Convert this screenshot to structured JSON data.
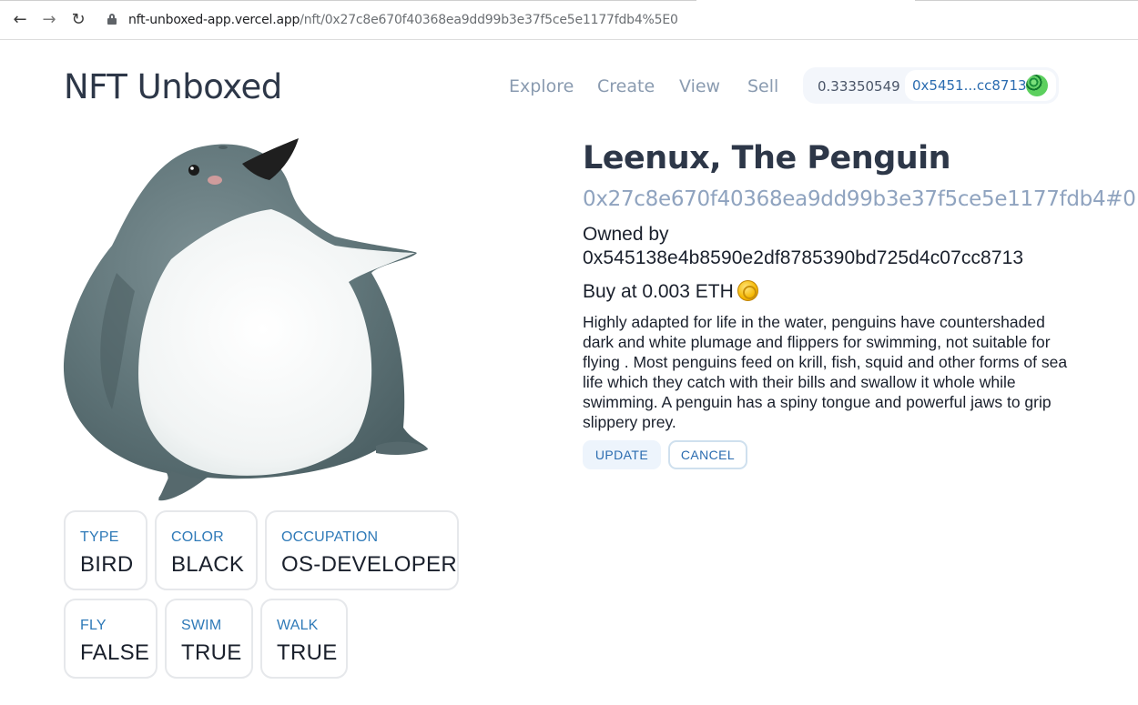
{
  "browser": {
    "url_host": "nft-unboxed-app.vercel.app",
    "url_path": "/nft/0x27c8e670f40368ea9dd99b3e37f5ce5e1177fdb4%5E0",
    "back_icon": "arrow-left-icon",
    "forward_icon": "arrow-right-icon",
    "reload_icon": "reload-icon",
    "lock_icon": "lock-icon"
  },
  "header": {
    "brand": "NFT Unboxed",
    "nav": {
      "explore": "Explore",
      "create": "Create",
      "view": "View",
      "sell": "Sell"
    },
    "wallet": {
      "balance": "0.33350549",
      "address": "0x5451...cc8713",
      "avatar_icon": "identicon-avatar"
    }
  },
  "nft": {
    "title": "Leenux, The Penguin",
    "token_id": "0x27c8e670f40368ea9dd99b3e37f5ce5e1177fdb4#0",
    "owned_label": "Owned by",
    "owner": "0x545138e4b8590e2df8785390bd725d4c07cc8713",
    "price_text": "Buy at 0.003 ETH",
    "price_icon": "coin-icon",
    "description": "Highly adapted for life in the water, penguins have countershaded dark and white plumage and flippers for swimming, not suitable for flying . Most penguins feed on krill, fish, squid and other forms of sea life which they catch with their bills and swallow it whole while swimming. A penguin has a spiny tongue and powerful jaws to grip slippery prey.",
    "image": "penguin-illustration"
  },
  "properties": [
    {
      "key": "TYPE",
      "value": "BIRD"
    },
    {
      "key": "COLOR",
      "value": "BLACK"
    },
    {
      "key": "OCCUPATION",
      "value": "OS-DEVELOPER"
    },
    {
      "key": "FLY",
      "value": "FALSE"
    },
    {
      "key": "SWIM",
      "value": "TRUE"
    },
    {
      "key": "WALK",
      "value": "TRUE"
    }
  ],
  "actions": {
    "update": "UPDATE",
    "cancel": "CANCEL"
  },
  "colors": {
    "accent": "#2b6cb0",
    "muted_id": "#8fa3bf",
    "nav_link": "#8a9bb0",
    "penguin_body": "#5f7478",
    "penguin_belly": "#f4f6f6"
  }
}
